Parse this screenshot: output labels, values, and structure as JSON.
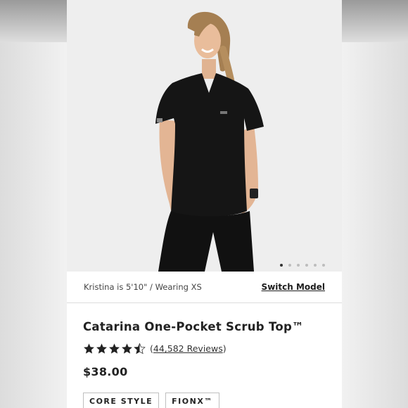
{
  "colors": {
    "accent": "#1d1d1d",
    "scrub": "#141414",
    "background": "#eeeeee"
  },
  "carousel": {
    "image_alt": "model-photo",
    "dot_count": 6,
    "active_index": 0
  },
  "model_bar": {
    "info": "Kristina is 5'10\" / Wearing XS",
    "switch_label": "Switch Model"
  },
  "product": {
    "title": "Catarina One-Pocket Scrub Top™",
    "rating": 4.5,
    "reviews_open": "(",
    "reviews_label": "44,582 Reviews",
    "reviews_close": ")",
    "price": "$38.00",
    "tags": [
      "CORE STYLE",
      "FIONX™"
    ]
  }
}
